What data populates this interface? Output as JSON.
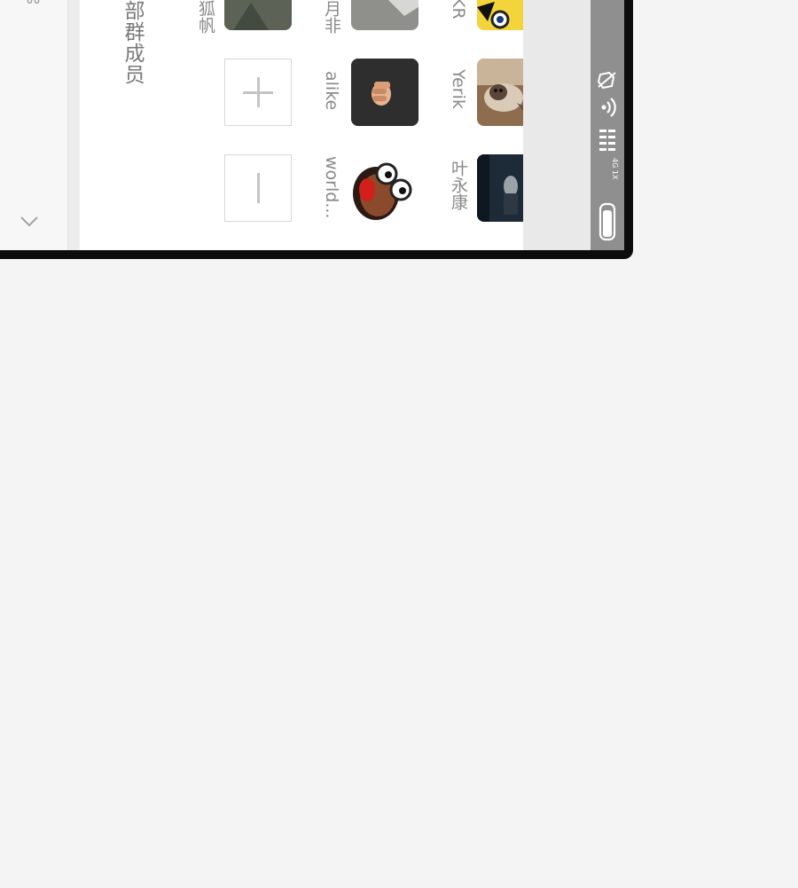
{
  "section": {
    "title": "部群成员"
  },
  "members": [
    {
      "name": "狐帆",
      "kind": "photo"
    },
    {
      "name": "月非",
      "kind": "photo"
    },
    {
      "name": "KR",
      "kind": "photo"
    },
    {
      "name": "alike",
      "kind": "fist"
    },
    {
      "name": "Yerik",
      "kind": "cat"
    },
    {
      "name": "world...",
      "kind": "cartoon"
    },
    {
      "name": "叶永康",
      "kind": "dark-photo"
    }
  ],
  "actions": {
    "add": "add-member",
    "remove": "remove-member"
  },
  "status": {
    "network": "4G",
    "network_sub": "1X",
    "icons": [
      "mute-icon",
      "wifi-icon",
      "signal-icon",
      "battery-icon"
    ]
  },
  "colors": {
    "background": "#f4f4f5",
    "frame": "#0c0c0c",
    "status_bar": "#8f8f90",
    "label": "#8a8a8a"
  }
}
